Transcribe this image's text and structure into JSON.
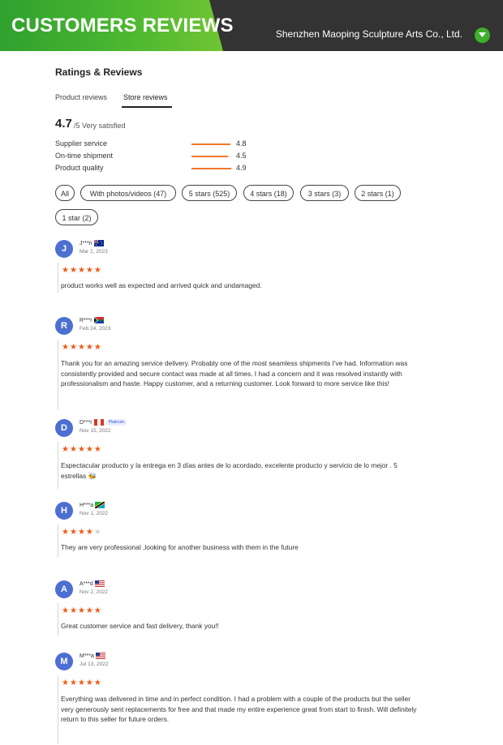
{
  "header": {
    "title": "CUSTOMERS REVIEWS",
    "company": "Shenzhen Maoping Sculpture Arts Co., Ltd.",
    "colors": {
      "green": "#4fb831",
      "dark": "#333333"
    }
  },
  "section_title": "Ratings & Reviews",
  "tabs": [
    {
      "label": "Product reviews",
      "active": false
    },
    {
      "label": "Store reviews",
      "active": true
    }
  ],
  "rating": {
    "score": "4.7",
    "suffix": "/5 Very satisfied"
  },
  "metrics": [
    {
      "label": "Supplier service",
      "value": "4.8",
      "fraction": 0.96
    },
    {
      "label": "On-time shipment",
      "value": "4.5",
      "fraction": 0.9
    },
    {
      "label": "Product quality",
      "value": "4.9",
      "fraction": 0.98
    }
  ],
  "filters": [
    "All",
    "With photos/videos (47)",
    "5 stars (525)",
    "4 stars (18)",
    "3 stars (3)",
    "2 stars (1)",
    "1 star (2)"
  ],
  "reviews": [
    {
      "initial": "J",
      "name": "J***n",
      "flag": "australia",
      "date": "Mar 2, 2023",
      "stars": 5,
      "badge": "",
      "text": "product works well as expected and arrived quick and undamaged."
    },
    {
      "initial": "R",
      "name": "R***r",
      "flag": "south-africa",
      "date": "Feb 24, 2023",
      "stars": 5,
      "badge": "",
      "text": "Thank you for an amazing service delivery. Probably one of the most seamless shipments I've had. Information was consistently provided and secure contact was made at all times. I had a concern and it was resolved instantly with professionalism and haste. Happy customer, and a returning customer. Look forward to more service like this!"
    },
    {
      "initial": "D",
      "name": "D***r",
      "flag": "peru",
      "date": "Nov 15, 2022",
      "stars": 5,
      "badge": "Platinum",
      "text": "Espectacular producto y la entrega en 3 días antes de lo acordado, excelente producto y servicio de lo mejor . 5 estrellas 🐝"
    },
    {
      "initial": "H",
      "name": "H***a",
      "flag": "tanzania",
      "date": "Nov 1, 2022",
      "stars": 4,
      "badge": "",
      "text": "They are very professional ,looking for another business with them in the future"
    },
    {
      "initial": "A",
      "name": "A***d",
      "flag": "usa",
      "date": "Nov 2, 2022",
      "stars": 5,
      "badge": "",
      "text": "Great customer service and fast delivery, thank you!!"
    },
    {
      "initial": "M",
      "name": "M***a",
      "flag": "usa",
      "date": "Jul 13, 2022",
      "stars": 5,
      "badge": "",
      "text": "Everything was delivered in time and in perfect condition. I had a problem with a couple of the products but the seller very generously sent replacements for free and that made my entire experience great from start to finish. Will definitely return to this seller for future orders."
    }
  ]
}
